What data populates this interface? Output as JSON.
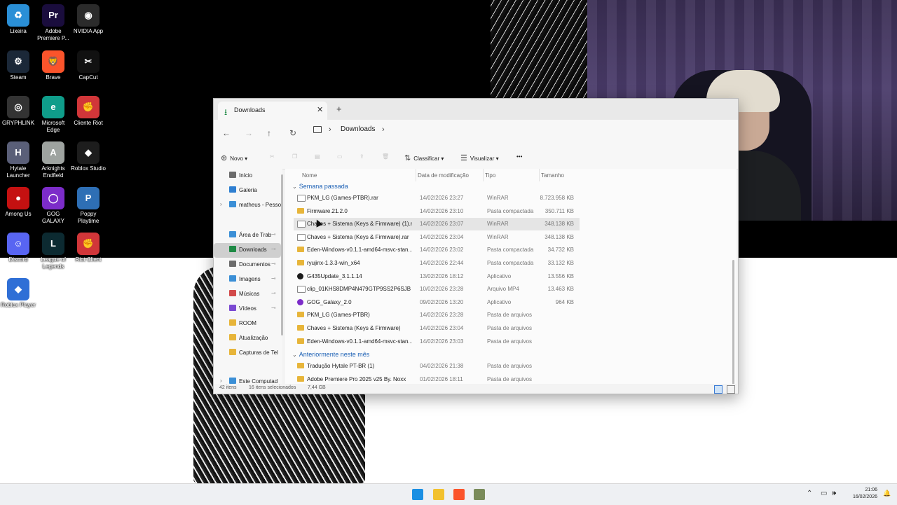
{
  "desktop": {
    "icons": [
      {
        "label": "Lixeira",
        "icon": "recycle-bin-icon",
        "color": "#2a8fd6",
        "glyph": "♻"
      },
      {
        "label": "Adobe Premiere P...",
        "icon": "premiere-icon",
        "color": "#1a0d3d",
        "glyph": "Pr"
      },
      {
        "label": "NVIDIA App",
        "icon": "nvidia-icon",
        "color": "#2b2b2b",
        "glyph": "◉"
      },
      {
        "label": "Steam",
        "icon": "steam-icon",
        "color": "#1b2838",
        "glyph": "⚙"
      },
      {
        "label": "Brave",
        "icon": "brave-icon",
        "color": "#fb542b",
        "glyph": "🦁"
      },
      {
        "label": "CapCut",
        "icon": "capcut-icon",
        "color": "#111111",
        "glyph": "✂"
      },
      {
        "label": "GRYPHLINK",
        "icon": "gryphlink-icon",
        "color": "#333333",
        "glyph": "◎"
      },
      {
        "label": "Microsoft Edge",
        "icon": "edge-icon",
        "color": "#0f9d8a",
        "glyph": "e"
      },
      {
        "label": "Cliente Riot",
        "icon": "riot-icon",
        "color": "#d13639",
        "glyph": "✊"
      },
      {
        "label": "Hytale Launcher",
        "icon": "hytale-icon",
        "color": "#5a5f78",
        "glyph": "H"
      },
      {
        "label": "Arknights Endfield",
        "icon": "arknights-icon",
        "color": "#9ea3a0",
        "glyph": "A"
      },
      {
        "label": "Roblox Studio",
        "icon": "roblox-studio-icon",
        "color": "#1d1d1d",
        "glyph": "◆"
      },
      {
        "label": "Among Us",
        "icon": "among-us-icon",
        "color": "#c51111",
        "glyph": "●"
      },
      {
        "label": "GOG GALAXY",
        "icon": "gog-icon",
        "color": "#7c2cc9",
        "glyph": "◯"
      },
      {
        "label": "Poppy Playtime",
        "icon": "poppy-icon",
        "color": "#2e6fb5",
        "glyph": "P"
      },
      {
        "label": "Discord",
        "icon": "discord-icon",
        "color": "#5865f2",
        "glyph": "☺"
      },
      {
        "label": "League of Legends",
        "icon": "lol-icon",
        "color": "#0c2a31",
        "glyph": "L"
      },
      {
        "label": "Riot Client",
        "icon": "riot-client-icon",
        "color": "#d13639",
        "glyph": "✊"
      },
      {
        "label": "Roblox Player",
        "icon": "roblox-player-icon",
        "color": "#2f6fd6",
        "glyph": "◆"
      }
    ]
  },
  "explorer": {
    "tab_title": "Downloads",
    "tab_close": "✕",
    "new_tab": "+",
    "breadcrumb": "Downloads",
    "commands": {
      "new": "Novo",
      "sort": "Classificar",
      "view": "Visualizar",
      "more": "•••"
    },
    "sidebar": [
      {
        "label": "Início",
        "icon": "home-icon",
        "color": "#6b6b6b"
      },
      {
        "label": "Galeria",
        "icon": "gallery-icon",
        "color": "#2f7fd1"
      },
      {
        "label": "matheus - Pesso",
        "icon": "onedrive-icon",
        "color": "#3b8fd6",
        "expand": true
      },
      {
        "label": "Área de Trab",
        "icon": "desktop-icon",
        "color": "#3b8fd6",
        "pin": true
      },
      {
        "label": "Downloads",
        "icon": "downloads-icon",
        "color": "#1e8a45",
        "pin": true,
        "selected": true
      },
      {
        "label": "Documentos",
        "icon": "documents-icon",
        "color": "#6b6b6b",
        "pin": true
      },
      {
        "label": "Imagens",
        "icon": "pictures-icon",
        "color": "#3b8fd6",
        "pin": true
      },
      {
        "label": "Músicas",
        "icon": "music-icon",
        "color": "#d24a4a",
        "pin": true
      },
      {
        "label": "Vídeos",
        "icon": "videos-icon",
        "color": "#7b4ad2",
        "pin": true
      },
      {
        "label": "ROOM",
        "icon": "folder-icon",
        "color": "#e7b53a"
      },
      {
        "label": "Atualização",
        "icon": "folder-icon",
        "color": "#e7b53a"
      },
      {
        "label": "Capturas de Tel",
        "icon": "folder-icon",
        "color": "#e7b53a"
      },
      {
        "label": "Este Computad",
        "icon": "computer-icon",
        "color": "#3b8fd6",
        "expand": true
      }
    ],
    "columns": {
      "name": "Nome",
      "date": "Data de modificação",
      "type": "Tipo",
      "size": "Tamanho"
    },
    "groups": [
      {
        "label": "Semana passada",
        "files": [
          {
            "name": "PKM_LG (Games-PTBR).rar",
            "date": "14/02/2026 23:27",
            "type": "WinRAR",
            "size": "8.723.958 KB",
            "kind": "archive"
          },
          {
            "name": "Firmware.21.2.0",
            "date": "14/02/2026 23:10",
            "type": "Pasta compactada",
            "size": "350.711 KB",
            "kind": "zip"
          },
          {
            "name": "Chaves + Sistema (Keys & Firmware) (1).r...",
            "date": "14/02/2026 23:07",
            "type": "WinRAR",
            "size": "348.138 KB",
            "kind": "archive",
            "hover": true
          },
          {
            "name": "Chaves + Sistema (Keys & Firmware).rar",
            "date": "14/02/2026 23:04",
            "type": "WinRAR",
            "size": "348.138 KB",
            "kind": "archive"
          },
          {
            "name": "Eden-Windows-v0.1.1-amd64-msvc-stan...",
            "date": "14/02/2026 23:02",
            "type": "Pasta compactada",
            "size": "34.732 KB",
            "kind": "zip"
          },
          {
            "name": "ryujinx-1.3.3-win_x64",
            "date": "14/02/2026 22:44",
            "type": "Pasta compactada",
            "size": "33.132 KB",
            "kind": "zip"
          },
          {
            "name": "G435Update_3.1.1.14",
            "date": "13/02/2026 18:12",
            "type": "Aplicativo",
            "size": "13.556 KB",
            "kind": "app-dark"
          },
          {
            "name": "clip_01KHS8DMP4N479GTP9SS2P6SJB",
            "date": "10/02/2026 23:28",
            "type": "Arquivo MP4",
            "size": "13.463 KB",
            "kind": "video"
          },
          {
            "name": "GOG_Galaxy_2.0",
            "date": "09/02/2026 13:20",
            "type": "Aplicativo",
            "size": "964 KB",
            "kind": "app-gog"
          },
          {
            "name": "PKM_LG (Games-PTBR)",
            "date": "14/02/2026 23:28",
            "type": "Pasta de arquivos",
            "size": "",
            "kind": "folder"
          },
          {
            "name": "Chaves + Sistema (Keys & Firmware)",
            "date": "14/02/2026 23:04",
            "type": "Pasta de arquivos",
            "size": "",
            "kind": "folder"
          },
          {
            "name": "Eden-Windows-v0.1.1-amd64-msvc-stan...",
            "date": "14/02/2026 23:03",
            "type": "Pasta de arquivos",
            "size": "",
            "kind": "folder"
          }
        ]
      },
      {
        "label": "Anteriormente neste mês",
        "files": [
          {
            "name": "Tradução Hytale PT-BR (1)",
            "date": "04/02/2026 21:38",
            "type": "Pasta de arquivos",
            "size": "",
            "kind": "folder"
          },
          {
            "name": "Adobe Premiere Pro 2025 v25 By. Noxx",
            "date": "01/02/2026 18:11",
            "type": "Pasta de arquivos",
            "size": "",
            "kind": "folder"
          }
        ]
      }
    ],
    "status": {
      "count": "42 itens",
      "selection": "16 itens selecionados",
      "size": "7,44 GB"
    }
  },
  "taskbar": {
    "apps": [
      {
        "icon": "windows-start-icon",
        "color": "#1a8fe3"
      },
      {
        "icon": "file-explorer-icon",
        "color": "#f2c12e"
      },
      {
        "icon": "brave-icon",
        "color": "#fb542b"
      },
      {
        "icon": "generic-app-icon",
        "color": "#7a8b5a"
      }
    ],
    "time": "21:06",
    "date": "16/02/2026"
  }
}
